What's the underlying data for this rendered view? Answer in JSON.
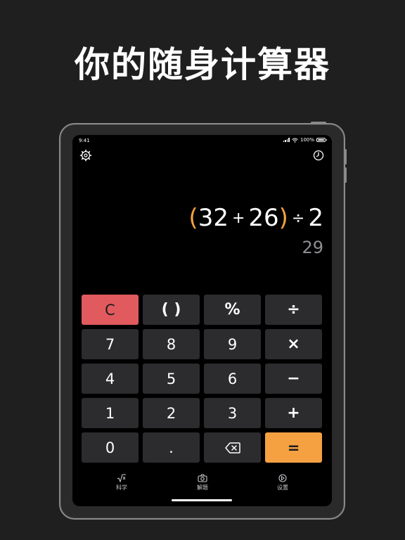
{
  "headline": "你的随身计算器",
  "status": {
    "time": "9:41",
    "battery": "100%"
  },
  "top_icons": {
    "left": "gear-icon",
    "right": "history-clock-icon"
  },
  "display": {
    "expression": {
      "open_paren": "(",
      "a": "32",
      "op1": "+",
      "b": "26",
      "close_paren": ")",
      "op2": "÷",
      "c": "2"
    },
    "result": "29"
  },
  "keys": [
    {
      "label": "C",
      "name": "clear-key",
      "kind": "clear"
    },
    {
      "label": "( )",
      "name": "parentheses-key",
      "kind": "op"
    },
    {
      "label": "%",
      "name": "percent-key",
      "kind": "op"
    },
    {
      "label": "÷",
      "name": "divide-key",
      "kind": "op"
    },
    {
      "label": "7",
      "name": "digit-7-key",
      "kind": "num"
    },
    {
      "label": "8",
      "name": "digit-8-key",
      "kind": "num"
    },
    {
      "label": "9",
      "name": "digit-9-key",
      "kind": "num"
    },
    {
      "label": "×",
      "name": "multiply-key",
      "kind": "op"
    },
    {
      "label": "4",
      "name": "digit-4-key",
      "kind": "num"
    },
    {
      "label": "5",
      "name": "digit-5-key",
      "kind": "num"
    },
    {
      "label": "6",
      "name": "digit-6-key",
      "kind": "num"
    },
    {
      "label": "−",
      "name": "minus-key",
      "kind": "op"
    },
    {
      "label": "1",
      "name": "digit-1-key",
      "kind": "num"
    },
    {
      "label": "2",
      "name": "digit-2-key",
      "kind": "num"
    },
    {
      "label": "3",
      "name": "digit-3-key",
      "kind": "num"
    },
    {
      "label": "+",
      "name": "plus-key",
      "kind": "op"
    },
    {
      "label": "0",
      "name": "digit-0-key",
      "kind": "num"
    },
    {
      "label": ".",
      "name": "decimal-key",
      "kind": "num"
    },
    {
      "label": "",
      "name": "backspace-key",
      "kind": "backspace"
    },
    {
      "label": "=",
      "name": "equals-key",
      "kind": "eq"
    }
  ],
  "tabs": [
    {
      "label": "科学",
      "icon": "square-root-icon"
    },
    {
      "label": "解题",
      "icon": "camera-icon"
    },
    {
      "label": "设置",
      "icon": "settings-icon"
    }
  ],
  "colors": {
    "accent": "#f5a142",
    "clear": "#e05a5e",
    "key": "#2c2c2e",
    "result": "#8e8e93",
    "background": "#1f1f1f"
  }
}
